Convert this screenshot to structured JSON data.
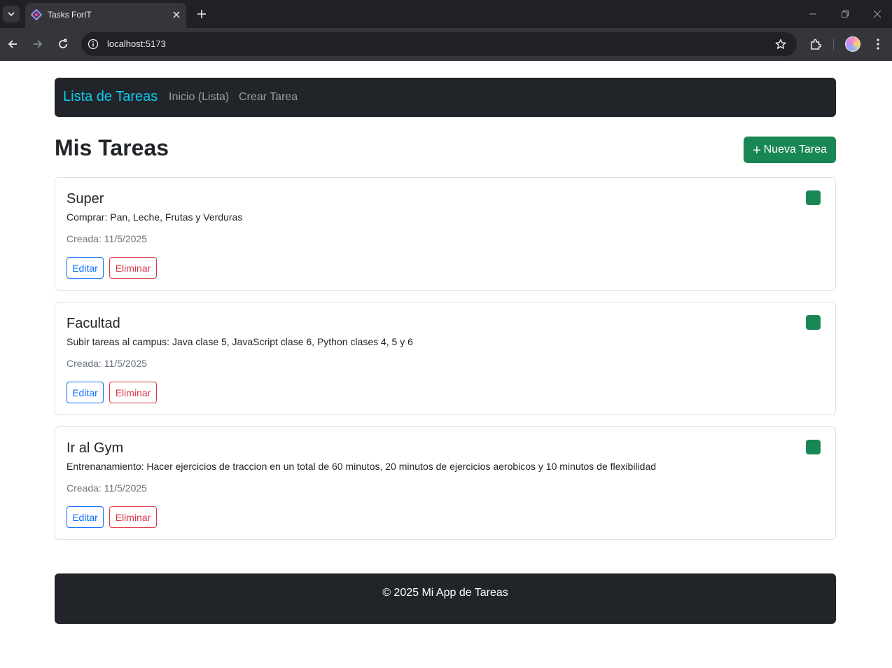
{
  "browser": {
    "tab_title": "Tasks ForIT",
    "url": "localhost:5173"
  },
  "navbar": {
    "brand": "Lista de Tareas",
    "links": [
      "Inicio (Lista)",
      "Crear Tarea"
    ]
  },
  "header": {
    "title": "Mis Tareas",
    "new_button_label": "Nueva Tarea",
    "new_button_icon": "+"
  },
  "tasks": [
    {
      "title": "Super",
      "description": "Comprar: Pan, Leche, Frutas y Verduras",
      "created": "Creada: 11/5/2025",
      "edit_label": "Editar",
      "delete_label": "Eliminar"
    },
    {
      "title": "Facultad",
      "description": "Subir tareas al campus: Java clase 5, JavaScript clase 6, Python clases 4, 5 y 6",
      "created": "Creada: 11/5/2025",
      "edit_label": "Editar",
      "delete_label": "Eliminar"
    },
    {
      "title": "Ir al Gym",
      "description": "Entrenanamiento: Hacer ejercicios de traccion en un total de 60 minutos, 20 minutos de ejercicios aerobicos y 10 minutos de flexibilidad",
      "created": "Creada: 11/5/2025",
      "edit_label": "Editar",
      "delete_label": "Eliminar"
    }
  ],
  "footer": {
    "text": "© 2025 Mi App de Tareas"
  },
  "colors": {
    "navbar_bg": "#212529",
    "brand": "#0dcaf0",
    "success": "#198754",
    "primary": "#0d6efd",
    "danger": "#dc3545"
  }
}
